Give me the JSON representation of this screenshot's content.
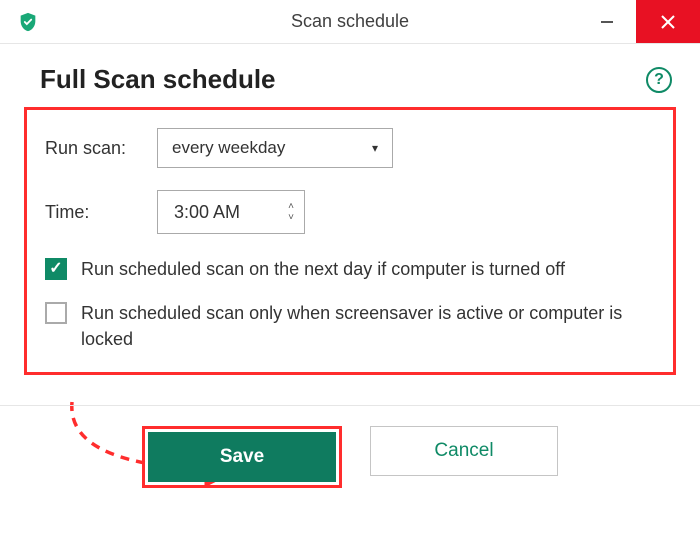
{
  "window": {
    "title": "Scan schedule"
  },
  "section": {
    "title": "Full Scan schedule"
  },
  "form": {
    "runscan_label": "Run scan:",
    "runscan_value": "every weekday",
    "time_label": "Time:",
    "time_value": "3:00 AM"
  },
  "checkboxes": {
    "next_day": {
      "label": "Run scheduled scan on the next day if computer is turned off",
      "checked": true
    },
    "screensaver": {
      "label": "Run scheduled scan only when screensaver is active or computer is locked",
      "checked": false
    }
  },
  "buttons": {
    "save": "Save",
    "cancel": "Cancel"
  },
  "colors": {
    "accent": "#0f8a66",
    "save_bg": "#0f7b5f",
    "annotation": "#ff2d2d",
    "close_bg": "#e81123"
  }
}
